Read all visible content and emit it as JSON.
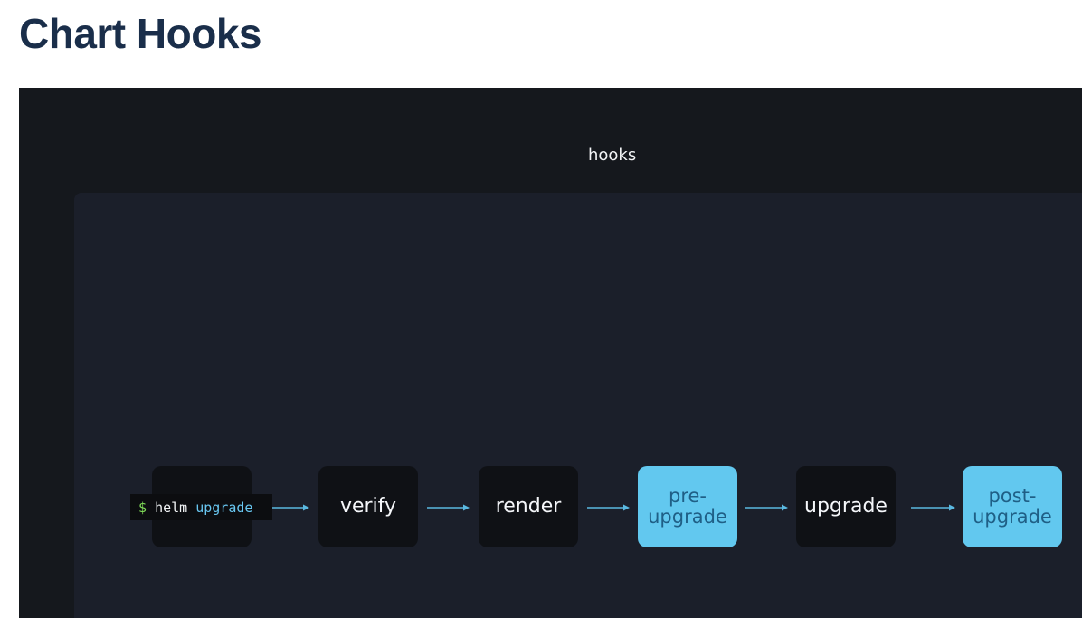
{
  "page": {
    "title": "Chart Hooks"
  },
  "diagram": {
    "label": "hooks",
    "command": {
      "prompt": "$",
      "program": "helm",
      "argument": "upgrade"
    },
    "steps": [
      {
        "id": "verify",
        "label": "verify",
        "hook": false
      },
      {
        "id": "render",
        "label": "render",
        "hook": false
      },
      {
        "id": "pre-upgrade",
        "label": "pre-\nupgrade",
        "hook": true
      },
      {
        "id": "upgrade",
        "label": "upgrade",
        "hook": false
      },
      {
        "id": "post-upgrade",
        "label": "post-\nupgrade",
        "hook": true
      }
    ],
    "colors": {
      "background": "#15181d",
      "panel": "#1b1f2a",
      "step": "#0f1115",
      "hook": "#62c8ef",
      "hook_text": "#1f5f86",
      "arrow": "#5ab8e0",
      "prompt": "#7ed957"
    }
  }
}
